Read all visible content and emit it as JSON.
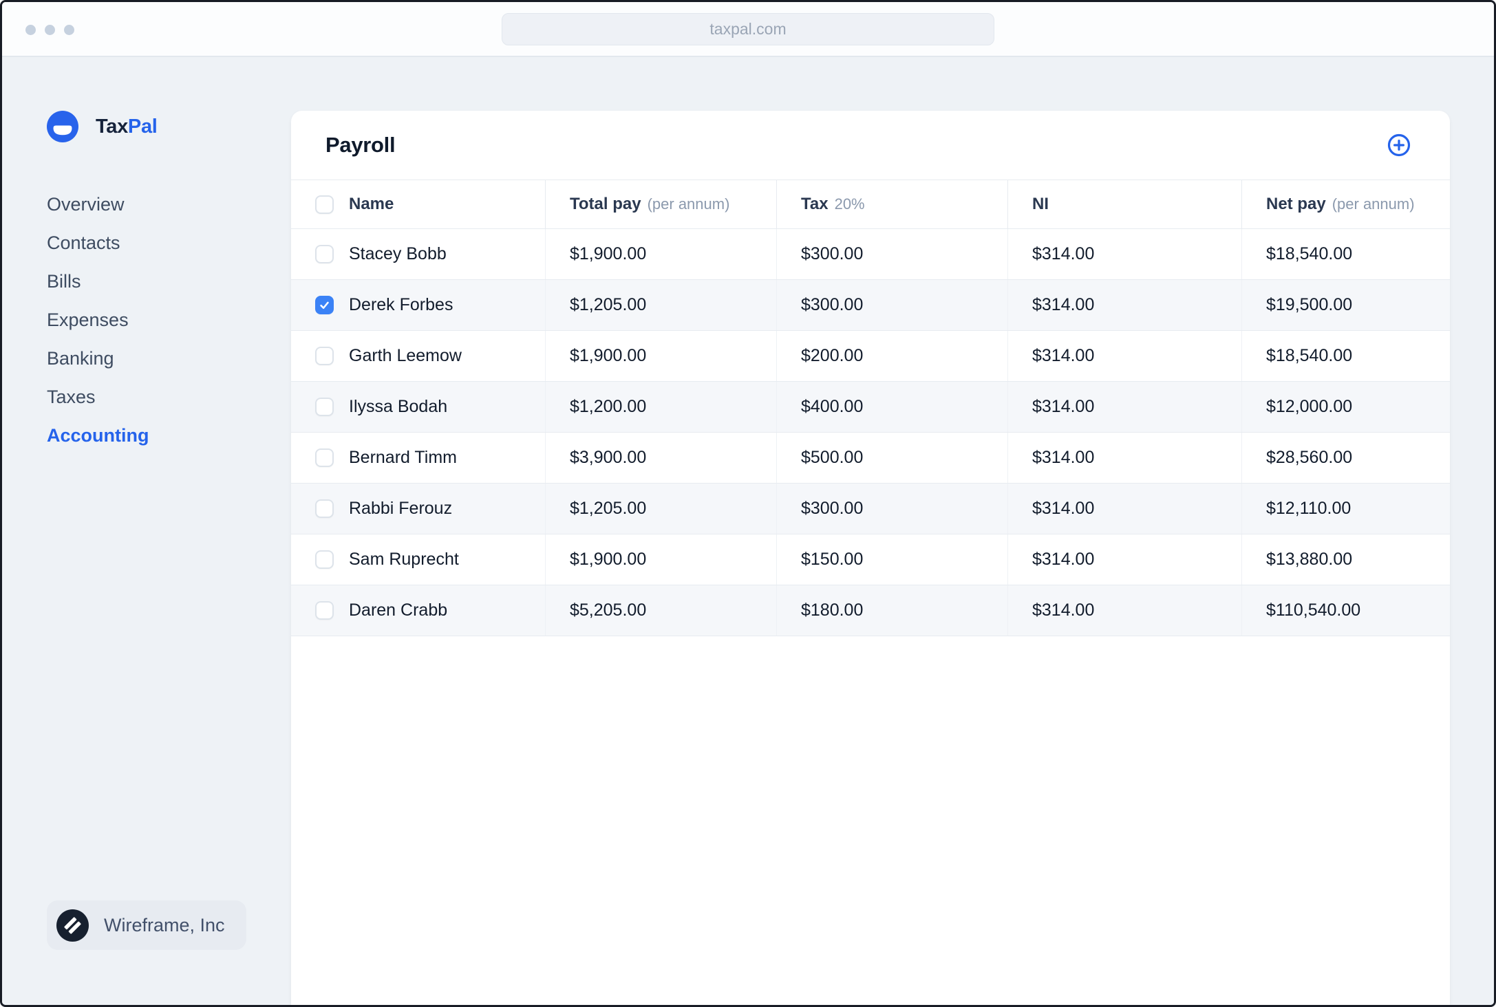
{
  "browser": {
    "url": "taxpal.com"
  },
  "brand": {
    "name_primary": "Tax",
    "name_secondary": "Pal"
  },
  "sidebar": {
    "items": [
      {
        "label": "Overview",
        "active": false
      },
      {
        "label": "Contacts",
        "active": false
      },
      {
        "label": "Bills",
        "active": false
      },
      {
        "label": "Expenses",
        "active": false
      },
      {
        "label": "Banking",
        "active": false
      },
      {
        "label": "Taxes",
        "active": false
      },
      {
        "label": "Accounting",
        "active": true
      }
    ],
    "footer": {
      "company": "Wireframe, Inc"
    }
  },
  "payroll": {
    "title": "Payroll",
    "columns": [
      {
        "label": "Name",
        "sub": ""
      },
      {
        "label": "Total pay",
        "sub": "(per annum)"
      },
      {
        "label": "Tax",
        "sub": "20%"
      },
      {
        "label": "NI",
        "sub": ""
      },
      {
        "label": "Net pay",
        "sub": "(per annum)"
      }
    ],
    "rows": [
      {
        "name": "Stacey Bobb",
        "total_pay": "$1,900.00",
        "tax": "$300.00",
        "ni": "$314.00",
        "net_pay": "$18,540.00",
        "checked": false
      },
      {
        "name": "Derek Forbes",
        "total_pay": "$1,205.00",
        "tax": "$300.00",
        "ni": "$314.00",
        "net_pay": "$19,500.00",
        "checked": true
      },
      {
        "name": "Garth Leemow",
        "total_pay": "$1,900.00",
        "tax": "$200.00",
        "ni": "$314.00",
        "net_pay": "$18,540.00",
        "checked": false
      },
      {
        "name": "Ilyssa Bodah",
        "total_pay": "$1,200.00",
        "tax": "$400.00",
        "ni": "$314.00",
        "net_pay": "$12,000.00",
        "checked": false
      },
      {
        "name": "Bernard Timm",
        "total_pay": "$3,900.00",
        "tax": "$500.00",
        "ni": "$314.00",
        "net_pay": "$28,560.00",
        "checked": false
      },
      {
        "name": "Rabbi Ferouz",
        "total_pay": "$1,205.00",
        "tax": "$300.00",
        "ni": "$314.00",
        "net_pay": "$12,110.00",
        "checked": false
      },
      {
        "name": "Sam Ruprecht",
        "total_pay": "$1,900.00",
        "tax": "$150.00",
        "ni": "$314.00",
        "net_pay": "$13,880.00",
        "checked": false
      },
      {
        "name": "Daren Crabb",
        "total_pay": "$5,205.00",
        "tax": "$180.00",
        "ni": "$314.00",
        "net_pay": "$110,540.00",
        "checked": false
      }
    ]
  },
  "colors": {
    "accent": "#2563eb",
    "checkbox_checked": "#3b82f6",
    "app_background": "#eef2f6",
    "row_alt_background": "#f5f7fa"
  }
}
